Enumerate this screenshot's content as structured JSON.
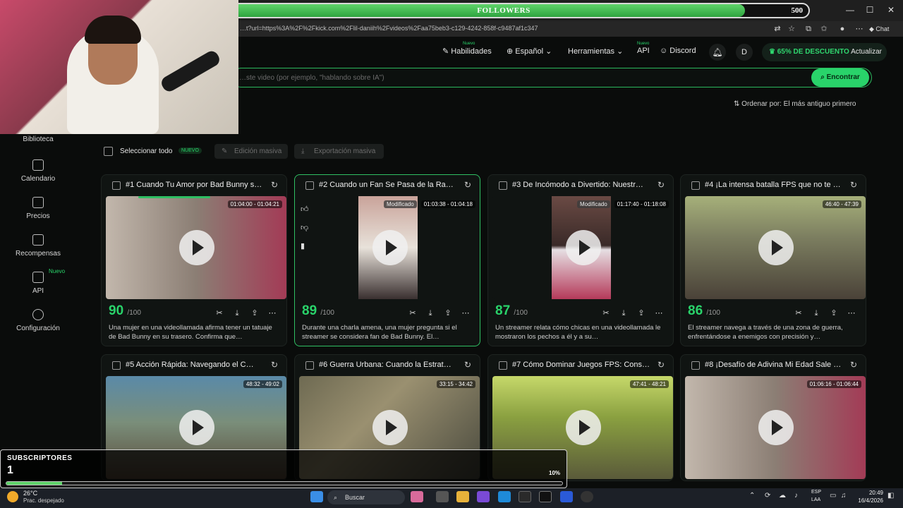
{
  "stream_overlay": {
    "followers": {
      "current": "448",
      "label": "FOLLOWERS",
      "goal": "500",
      "progress": 0.896
    },
    "subscribers": {
      "label": "SUBSCRIPTORES",
      "count": "1",
      "progress": 0.1,
      "percent_label": "10%"
    }
  },
  "browser": {
    "url": "…t?url=https%3A%2F%2Fkick.com%2Flil-daniih%2Fvideos%2Faa75beb3-c129-4242-858f-c9487af1c347",
    "chat_label": "Chat"
  },
  "topnav": {
    "skills": "Habilidades",
    "skills_badge": "Nuevo",
    "language": "Español",
    "tools": "Herramientas",
    "api": "API",
    "api_badge": "Nuevo",
    "discord": "Discord",
    "avatar_initial": "D",
    "discount_text": "65% DE DESCUENTO",
    "upgrade_text": "Actualizar"
  },
  "search": {
    "placeholder": "…ste video (por ejemplo, \"hablando sobre IA\")",
    "button": "Encontrar"
  },
  "sort": {
    "label": "Ordenar por: El más antiguo primero"
  },
  "sidebar": {
    "items": [
      {
        "label": "Biblioteca"
      },
      {
        "label": "Calendario"
      },
      {
        "label": "Precios"
      },
      {
        "label": "Recompensas"
      },
      {
        "label": "API"
      },
      {
        "label": "Configuración"
      }
    ],
    "api_badge": "Nuevo"
  },
  "bulk": {
    "select_all": "Seleccionar todo",
    "select_all_badge": "NUEVO",
    "bulk_edit": "Edición masiva",
    "bulk_export": "Exportación masiva"
  },
  "clips": [
    {
      "title": "#1 Cuando Tu Amor por Bad Bunny s…",
      "time": "01:04:00 - 01:04:21",
      "modified": "",
      "score": "90",
      "score_total": "/100",
      "desc": "Una mujer en una videollamada afirma tener un tatuaje de Bad Bunny en su trasero. Confirma que…"
    },
    {
      "title": "#2 Cuando un Fan Se Pasa de la Ra…",
      "time": "01:03:38 - 01:04:18",
      "modified": "Modificado",
      "score": "89",
      "score_total": "/100",
      "desc": "Durante una charla amena, una mujer pregunta si el streamer se considera fan de Bad Bunny. El…"
    },
    {
      "title": "#3 De Incómodo a Divertido: Nuestr…",
      "time": "01:17:40 - 01:18:08",
      "modified": "Modificado",
      "score": "87",
      "score_total": "/100",
      "desc": "Un streamer relata cómo chicas en una videollamada le mostraron los pechos a él y a su…"
    },
    {
      "title": "#4 ¡La intensa batalla FPS que no te …",
      "time": "46:40 - 47:39",
      "modified": "",
      "score": "86",
      "score_total": "/100",
      "desc": "El streamer navega a través de una zona de guerra, enfrentándose a enemigos con precisión y…"
    },
    {
      "title": "#5 Acción Rápida: Navegando el C…",
      "time": "48:32 - 49:02",
      "modified": "",
      "score": "",
      "score_total": "",
      "desc": ""
    },
    {
      "title": "#6 Guerra Urbana: Cuando la Estrat…",
      "time": "33:15 - 34:42",
      "modified": "",
      "score": "",
      "score_total": "",
      "desc": ""
    },
    {
      "title": "#7 Cómo Dominar Juegos FPS: Cons…",
      "time": "47:41 - 48:21",
      "modified": "",
      "score": "",
      "score_total": "",
      "desc": ""
    },
    {
      "title": "#8 ¡Desafío de Adivina Mi Edad Sale …",
      "time": "01:06:16 - 01:06:44",
      "modified": "",
      "score": "",
      "score_total": "",
      "desc": ""
    }
  ],
  "taskbar": {
    "temperature": "26°C",
    "weather": "Prac. despejado",
    "search": "Buscar",
    "lang_1": "ESP",
    "lang_2": "LAA",
    "time": "20:49",
    "date": "16/4/2026"
  },
  "colors": {
    "accent": "#29d36a",
    "background": "#0a0c0b",
    "card": "#101412"
  }
}
